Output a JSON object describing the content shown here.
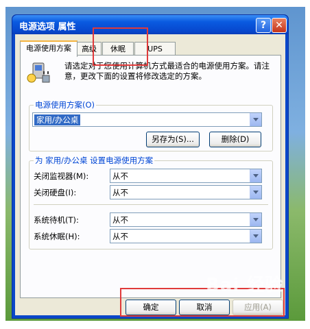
{
  "window": {
    "title": "电源选项 属性",
    "help_label": "?",
    "close_label": "✕"
  },
  "tabs": [
    {
      "label": "电源使用方案"
    },
    {
      "label": "高级"
    },
    {
      "label": "休眠"
    },
    {
      "label": "UPS"
    }
  ],
  "description": "请选定对于您使用计算机方式最适合的电源使用方案。请注意，更改下面的设置将修改选定的方案。",
  "scheme": {
    "group_label": "电源使用方案(O)",
    "selected": "家用/办公桌",
    "save_as_label": "另存为(S)...",
    "delete_label": "删除(D)"
  },
  "settings": {
    "group_label": "为 家用/办公桌 设置电源使用方案",
    "rows": [
      {
        "label": "关闭监视器(M):",
        "value": "从不"
      },
      {
        "label": "关闭硬盘(I):",
        "value": "从不"
      },
      {
        "label": "系统待机(T):",
        "value": "从不"
      },
      {
        "label": "系统休眠(H):",
        "value": "从不"
      }
    ]
  },
  "buttons": {
    "ok": "确定",
    "cancel": "取消",
    "apply": "应用(A)"
  },
  "watermark": "Bai 经验",
  "colors": {
    "title_blue": "#0747cd",
    "dialog_bg": "#ece9d8",
    "highlight": "#316ac5",
    "annotation_red": "#e03a3a"
  }
}
